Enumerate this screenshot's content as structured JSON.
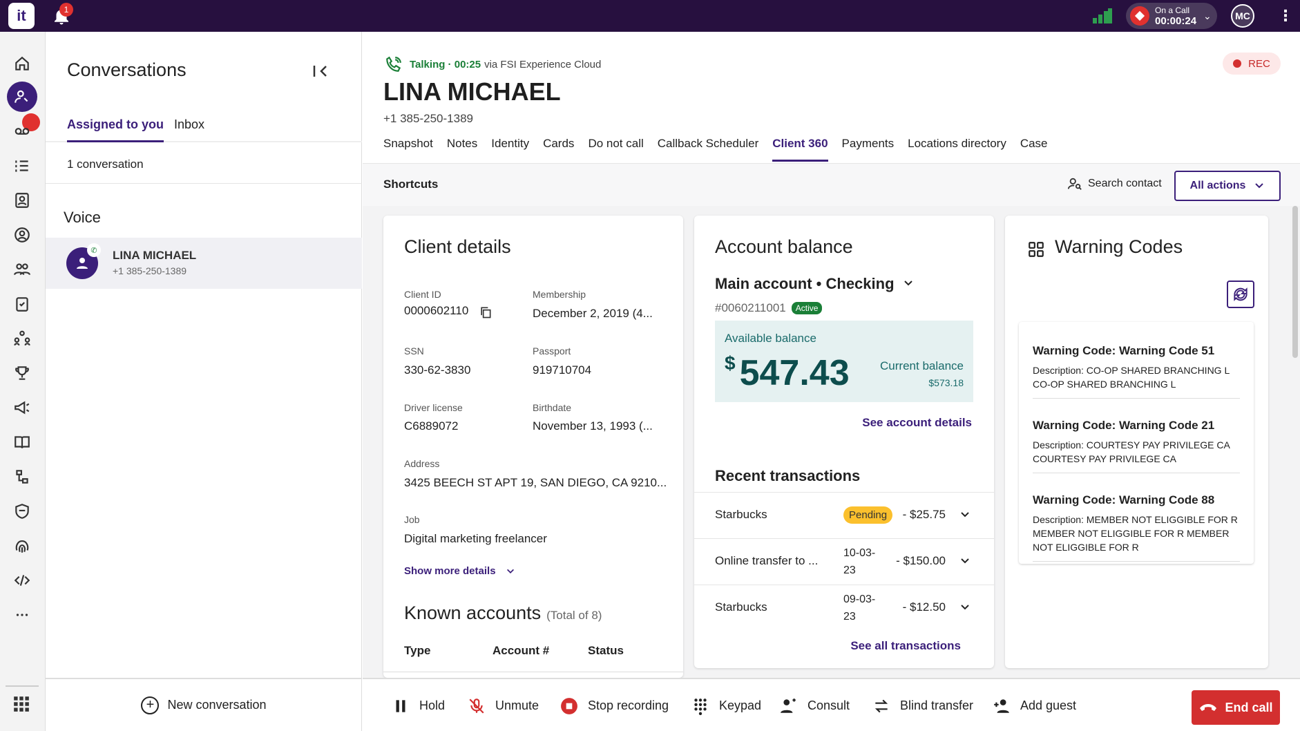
{
  "topbar": {
    "logo": "it",
    "notification_count": "1",
    "call_status_label": "On a Call",
    "call_timer": "00:00:24",
    "user_initials": "MC",
    "more": "⋮"
  },
  "conversations": {
    "title": "Conversations",
    "tabs": [
      "Assigned to you",
      "Inbox"
    ],
    "count": "1 conversation",
    "section": "Voice",
    "items": [
      {
        "name": "LINA MICHAEL",
        "phone": "+1 385-250-1389"
      }
    ],
    "new_label": "New conversation"
  },
  "contact": {
    "status_talking": "Talking · 00:25",
    "status_via": "via FSI Experience Cloud",
    "name": "LINA MICHAEL",
    "phone": "+1 385-250-1389",
    "rec": "REC"
  },
  "tabs": [
    "Snapshot",
    "Notes",
    "Identity",
    "Cards",
    "Do not call",
    "Callback Scheduler",
    "Client 360",
    "Payments",
    "Locations directory",
    "Case"
  ],
  "shortcuts": {
    "title": "Shortcuts",
    "search_contact": "Search contact",
    "all_actions": "All actions"
  },
  "client_details": {
    "title": "Client details",
    "client_id_label": "Client ID",
    "client_id": "0000602110",
    "membership_label": "Membership",
    "membership": "December 2, 2019 (4...",
    "ssn_label": "SSN",
    "ssn": "330-62-3830",
    "passport_label": "Passport",
    "passport": "919710704",
    "license_label": "Driver license",
    "license": "C6889072",
    "birthdate_label": "Birthdate",
    "birthdate": "November 13, 1993 (...",
    "address_label": "Address",
    "address": "3425 BEECH ST APT 19, SAN DIEGO, CA 9210...",
    "job_label": "Job",
    "job": "Digital marketing freelancer",
    "show_more": "Show more details",
    "known_title": "Known accounts",
    "known_total": "(Total of 8)",
    "known_headers": [
      "Type",
      "Account #",
      "Status"
    ]
  },
  "account_balance": {
    "title": "Account balance",
    "account": "Main account • Checking",
    "number": "#0060211001",
    "active": "Active",
    "available_label": "Available balance",
    "currency": "$",
    "available": "547.43",
    "current_label": "Current balance",
    "current": "$573.18",
    "see_details": "See account details",
    "recent_title": "Recent transactions",
    "transactions": [
      {
        "name": "Starbucks",
        "date": "",
        "status": "Pending",
        "amount": "- $25.75"
      },
      {
        "name": "Online transfer to ...",
        "date": "10-03-23",
        "status": "",
        "amount": "- $150.00"
      },
      {
        "name": "Starbucks",
        "date": "09-03-23",
        "status": "",
        "amount": "- $12.50"
      }
    ],
    "see_all": "See all transactions"
  },
  "warning_codes": {
    "title": "Warning Codes",
    "items": [
      {
        "heading": "Warning Code: Warning Code 51",
        "description": "Description: CO-OP SHARED BRANCHING L CO-OP SHARED BRANCHING L"
      },
      {
        "heading": "Warning Code: Warning Code 21",
        "description": "Description: COURTESY PAY PRIVILEGE CA COURTESY PAY PRIVILEGE CA"
      },
      {
        "heading": "Warning Code: Warning Code 88",
        "description": "Description: MEMBER NOT ELIGGIBLE FOR R MEMBER NOT ELIGGIBLE FOR R MEMBER NOT ELIGGIBLE FOR R"
      }
    ]
  },
  "callbar": {
    "hold": "Hold",
    "unmute": "Unmute",
    "stop_recording": "Stop recording",
    "keypad": "Keypad",
    "consult": "Consult",
    "blind_transfer": "Blind transfer",
    "add_guest": "Add guest",
    "end_call": "End call"
  },
  "colors": {
    "topbar": "#27103f",
    "accent": "#3b1f7a",
    "danger": "#d32f2f",
    "success": "#1a7f37",
    "balance_bg": "#e5f1f1"
  }
}
